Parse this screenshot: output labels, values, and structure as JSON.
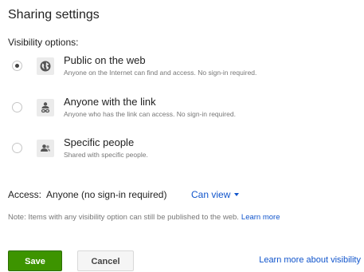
{
  "dialog": {
    "title": "Sharing settings",
    "visibility_label": "Visibility options:"
  },
  "options": [
    {
      "title": "Public on the web",
      "description": "Anyone on the Internet can find and access. No sign-in required.",
      "icon": "globe-icon",
      "selected": true
    },
    {
      "title": "Anyone with the link",
      "description": "Anyone who has the link can access. No sign-in required.",
      "icon": "link-person-icon",
      "selected": false
    },
    {
      "title": "Specific people",
      "description": "Shared with specific people.",
      "icon": "people-icon",
      "selected": false
    }
  ],
  "access": {
    "label": "Access:",
    "value": "Anyone (no sign-in required)",
    "permission": "Can view"
  },
  "note": {
    "text": "Note: Items with any visibility option can still be published to the web.",
    "link": "Learn more"
  },
  "buttons": {
    "save": "Save",
    "cancel": "Cancel"
  },
  "footer_link": "Learn more about visibility",
  "colors": {
    "link": "#1155cc",
    "save_button": "#3d9400",
    "muted_text": "#777777"
  }
}
